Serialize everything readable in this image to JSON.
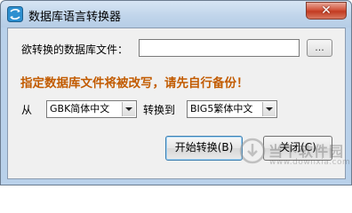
{
  "window": {
    "title": "数据库语言转换器",
    "close_label": "✕"
  },
  "form": {
    "file_label": "欲转换的数据库文件：",
    "file_value": "",
    "browse_label": "...",
    "warning": "指定数据库文件将被改写，请先自行备份！",
    "from_label": "从",
    "from_value": "GBK简体中文",
    "to_label": "转换到",
    "to_value": "BIG5繁体中文"
  },
  "buttons": {
    "start": "开始转换(B)",
    "close": "关闭(C)"
  },
  "watermark": {
    "text": "当下软件园",
    "url": "www.downxia.com"
  },
  "icons": {
    "app": "app-icon",
    "close": "close-icon",
    "dropdown": "chevron-down-icon",
    "watermark": "download-logo-icon"
  },
  "colors": {
    "warning": "#c25b00",
    "titlebar": "#bfd4ea",
    "close_button": "#c23b21"
  }
}
